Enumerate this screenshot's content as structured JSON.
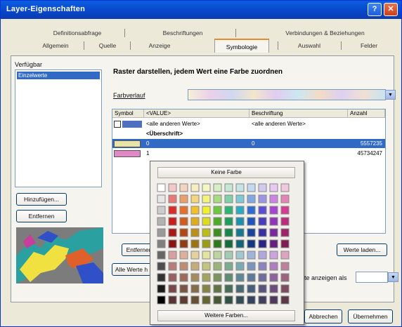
{
  "window": {
    "title": "Layer-Eigenschaften",
    "help_icon": "?",
    "close_icon": "✕"
  },
  "tabs_row1": [
    "Definitionsabfrage",
    "Beschriftungen",
    "Verbindungen & Beziehungen"
  ],
  "tabs_row2": [
    "Allgemein",
    "Quelle",
    "Anzeige",
    "Symbologie",
    "Auswahl",
    "Felder"
  ],
  "left": {
    "available_label": "Verfügbar",
    "list_items": [
      "Einzelwerte"
    ],
    "add_button": "Hinzufügen...",
    "remove_button": "Entfernen"
  },
  "main": {
    "heading": "Raster darstellen, jedem Wert eine Farbe zuordnen",
    "field_label": "Farbverlauf",
    "columns": [
      "Symbol",
      "<VALUE>",
      "Beschriftung",
      "Anzahl"
    ],
    "rows": [
      {
        "symbol_color": "#4f6fbf",
        "value": "<alle anderen Werte>",
        "label": "<alle anderen Werte>",
        "count": ""
      },
      {
        "symbol_color": "",
        "value": "<Überschrift>",
        "label": "",
        "count": ""
      },
      {
        "symbol_color": "#e8e4a8",
        "value": "0",
        "label": "0",
        "count": "5557235"
      },
      {
        "symbol_color": "#e089c4",
        "value": "1",
        "label": "",
        "count": "45734247"
      }
    ],
    "remove_values_button": "Entfernen",
    "more_values_button": "Werte laden...",
    "all_values_label": "Alle Werte h",
    "show_as_label": "te anzeigen als",
    "show_as_value": ""
  },
  "color_popup": {
    "no_color": "Keine Farbe",
    "more_colors": "Weitere Farben...",
    "palette_rows": [
      [
        "#ffffff",
        "#f2c8c8",
        "#f2d4c0",
        "#f6edc4",
        "#f6f6c4",
        "#d8efc4",
        "#c4e8d4",
        "#c4e4e8",
        "#c4d8f0",
        "#d0ccf0",
        "#e8c8f0",
        "#f0c8dc"
      ],
      [
        "#e6e6e6",
        "#e87878",
        "#ec9e6c",
        "#f4d67c",
        "#f4f47c",
        "#a8dc80",
        "#80d0a8",
        "#80c8d8",
        "#80a8e4",
        "#9c94e4",
        "#cc84e4",
        "#e484b8"
      ],
      [
        "#cccccc",
        "#dc2c2c",
        "#e4702c",
        "#f0c02c",
        "#f0f02c",
        "#6cc83c",
        "#2cb474",
        "#2caac4",
        "#2c6cd4",
        "#5c4cd4",
        "#a844d4",
        "#d43c94"
      ],
      [
        "#b2b2b2",
        "#c81e1e",
        "#d05c1e",
        "#dcac1e",
        "#dcdc1e",
        "#4cac28",
        "#1e9c5c",
        "#1e90ac",
        "#1e54bc",
        "#483cbc",
        "#9034bc",
        "#bc2c7c"
      ],
      [
        "#999999",
        "#a81818",
        "#b04818",
        "#bc9018",
        "#bcbc18",
        "#3c9020",
        "#18844c",
        "#187890",
        "#18449c",
        "#3830a0",
        "#78289c",
        "#a02468"
      ],
      [
        "#808080",
        "#881414",
        "#903c14",
        "#9c7414",
        "#9c9c14",
        "#30781c",
        "#146c3c",
        "#146478",
        "#143880",
        "#2c2484",
        "#642080",
        "#841c54"
      ],
      [
        "#666666",
        "#d8a0a0",
        "#dcb09c",
        "#e4d0a0",
        "#e4e4a0",
        "#bcd4a0",
        "#a0ccb4",
        "#a0c8d0",
        "#a0b4d8",
        "#b0a8dc",
        "#cca4dc",
        "#dca4c0"
      ],
      [
        "#4d4d4d",
        "#b87c7c",
        "#bc8c74",
        "#c4ac7c",
        "#c4c47c",
        "#9cb47c",
        "#7cac90",
        "#7ca8b4",
        "#7c94bc",
        "#8c84bc",
        "#ac80bc",
        "#bc809c"
      ],
      [
        "#333333",
        "#986060",
        "#9c6c58",
        "#a48c60",
        "#a4a460",
        "#7c9460",
        "#608c74",
        "#608894",
        "#60789c",
        "#706c9c",
        "#8c649c",
        "#9c647c"
      ],
      [
        "#1a1a1a",
        "#784848",
        "#7c5444",
        "#846c48",
        "#848448",
        "#607448",
        "#486c58",
        "#486874",
        "#485c7c",
        "#58547c",
        "#6c4c7c",
        "#7c4c60"
      ],
      [
        "#000000",
        "#583434",
        "#5c3c30",
        "#645034",
        "#646434",
        "#485834",
        "#345044",
        "#344c58",
        "#34445c",
        "#40405c",
        "#50385c",
        "#5c3848"
      ]
    ]
  },
  "footer": {
    "cancel_button": "Abbrechen",
    "apply_button": "Übernehmen"
  }
}
